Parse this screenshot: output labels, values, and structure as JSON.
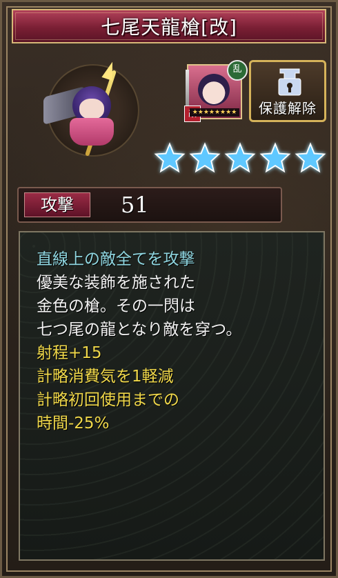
{
  "title": "七尾天龍槍[改]",
  "portrait": {
    "icon": "character-chibi-spear-icon"
  },
  "mini_card": {
    "icon": "character-card-icon",
    "badge_top": "乱",
    "badge_bottom": "改",
    "stars": "★★★★★★★★"
  },
  "protect_button": {
    "label": "保護解除",
    "icon": "lock-icon"
  },
  "rarity": {
    "stars": 5,
    "color": "#5fc8ff"
  },
  "stat": {
    "label": "攻撃",
    "value": "51"
  },
  "description": [
    {
      "text": "直線上の敵全てを攻撃",
      "color": "cyan"
    },
    {
      "text": "優美な装飾を施された",
      "color": "white"
    },
    {
      "text": "金色の槍。その一閃は",
      "color": "white"
    },
    {
      "text": "七つ尾の龍となり敵を穿つ。",
      "color": "white"
    },
    {
      "text": "射程+15",
      "color": "yellow"
    },
    {
      "text": "計略消費気を1軽減",
      "color": "yellow"
    },
    {
      "text": "計略初回使用までの",
      "color": "yellow"
    },
    {
      "text": "時間-25%",
      "color": "yellow"
    }
  ]
}
